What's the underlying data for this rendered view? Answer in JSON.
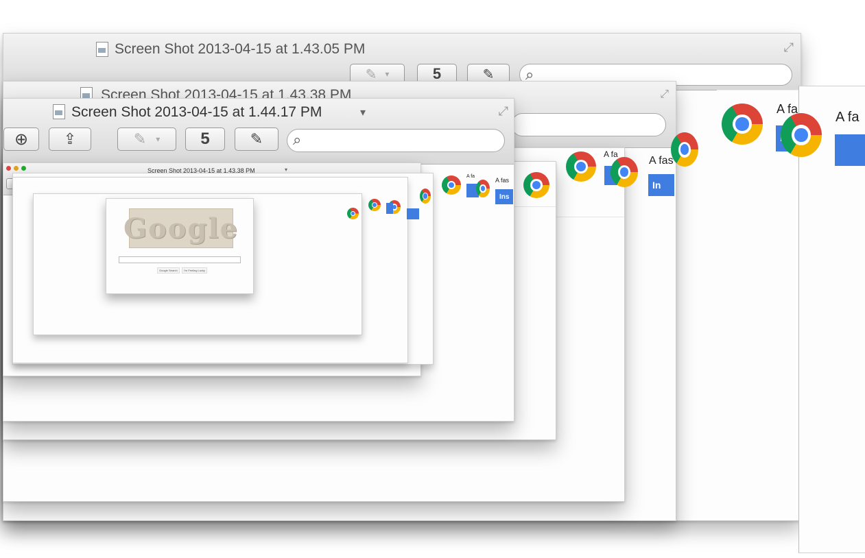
{
  "windows": {
    "back_title": "Screen Shot 2013-04-15 at 1.43.05 PM",
    "middle_title": "Screen Shot 2013-04-15 at 1.43.38 PM",
    "front_title": "Screen Shot 2013-04-15 at 1.44.17 PM",
    "front_title_caret": "▾",
    "inner_title": "Screen Shot 2013-04-15 at 1.43.38 PM",
    "inner_title_caret": "▾"
  },
  "toolbar": {
    "rotate_label": "5",
    "annotate_glyph": "✎",
    "search_glyph": "⌕",
    "zoom_in_glyph": "⊕",
    "zoom_out_glyph": "⊖",
    "share_glyph": "⇪",
    "dropdown_caret": "▾"
  },
  "chrome_page": {
    "tagline_1": "A fa",
    "tagline_2": "A fas",
    "tagline_3": "A fa",
    "tagline_4": "A fa",
    "tagline_5": "A fas",
    "tagline_6": "A fa",
    "install_label": "In",
    "install_label_small": "Ins"
  },
  "google_page": {
    "logo_text": "Google",
    "button_search": "Google Search",
    "button_lucky": "I'm Feeling Lucky"
  },
  "colors": {
    "install_blue": "#3f7ee0",
    "chrome_red": "#db4437",
    "chrome_yellow": "#f4b400",
    "chrome_green": "#0f9d58",
    "chrome_blue": "#4285f4"
  }
}
